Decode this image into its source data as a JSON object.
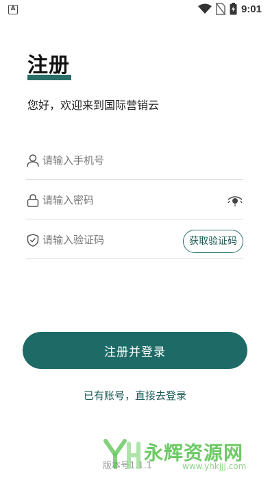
{
  "status_bar": {
    "notification_icon_letter": "A",
    "time": "9:01"
  },
  "page": {
    "title": "注册",
    "subtitle": "您好，欢迎来到国际营销云"
  },
  "form": {
    "phone": {
      "placeholder": "请输入手机号",
      "icon": "user-icon"
    },
    "password": {
      "placeholder": "请输入密码",
      "icon": "lock-icon",
      "toggle_icon": "eye-icon"
    },
    "code": {
      "placeholder": "请输入验证码",
      "icon": "shield-icon",
      "button_label": "获取验证码"
    }
  },
  "actions": {
    "register_label": "注册并登录",
    "login_link": "已有账号，直接去登录"
  },
  "footer": {
    "version": "版本号1.1.1"
  },
  "watermark": {
    "brand": "永辉资源网",
    "url": "www.yhkjjj.com"
  },
  "colors": {
    "accent": "#1e6a66",
    "accent_text": "#1d5a55",
    "divider": "#d8d8d8",
    "watermark": "#54c04b"
  }
}
